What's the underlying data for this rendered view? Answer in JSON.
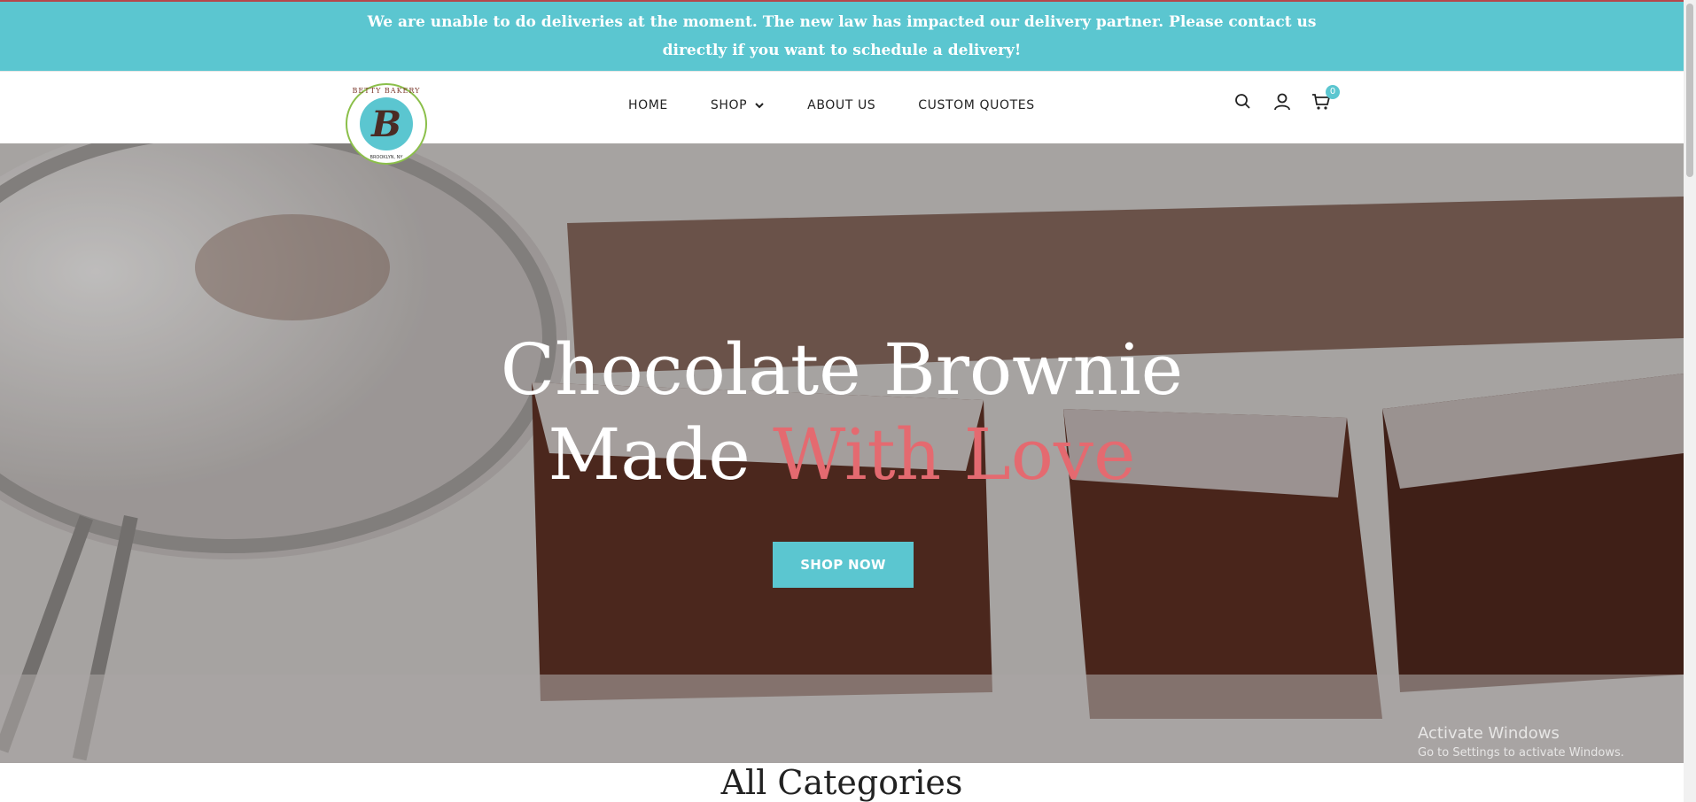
{
  "announcement": {
    "text": "We are unable to do deliveries at the moment. The new law has impacted our delivery partner. Please contact us directly if you want to schedule a delivery!"
  },
  "logo": {
    "name": "BETTY BAKERY",
    "letter": "B",
    "location": "BROOKLYN, NY"
  },
  "nav": {
    "items": [
      {
        "label": "HOME"
      },
      {
        "label": "SHOP"
      },
      {
        "label": "ABOUT US"
      },
      {
        "label": "CUSTOM QUOTES"
      }
    ]
  },
  "header_icons": {
    "search": "search-icon",
    "account": "user-icon",
    "cart": "cart-icon",
    "cart_count": "0"
  },
  "hero": {
    "line1": "Chocolate Brownie",
    "line2_part1": "Made",
    "line2_part2": "With Love",
    "cta": "SHOP NOW",
    "accent_color": "#e46a70",
    "button_color": "#5bc6d0"
  },
  "section": {
    "title": "All Categories"
  },
  "watermark": {
    "line1": "Activate Windows",
    "line2": "Go to Settings to activate Windows."
  },
  "colors": {
    "brand_teal": "#5bc6d0"
  }
}
